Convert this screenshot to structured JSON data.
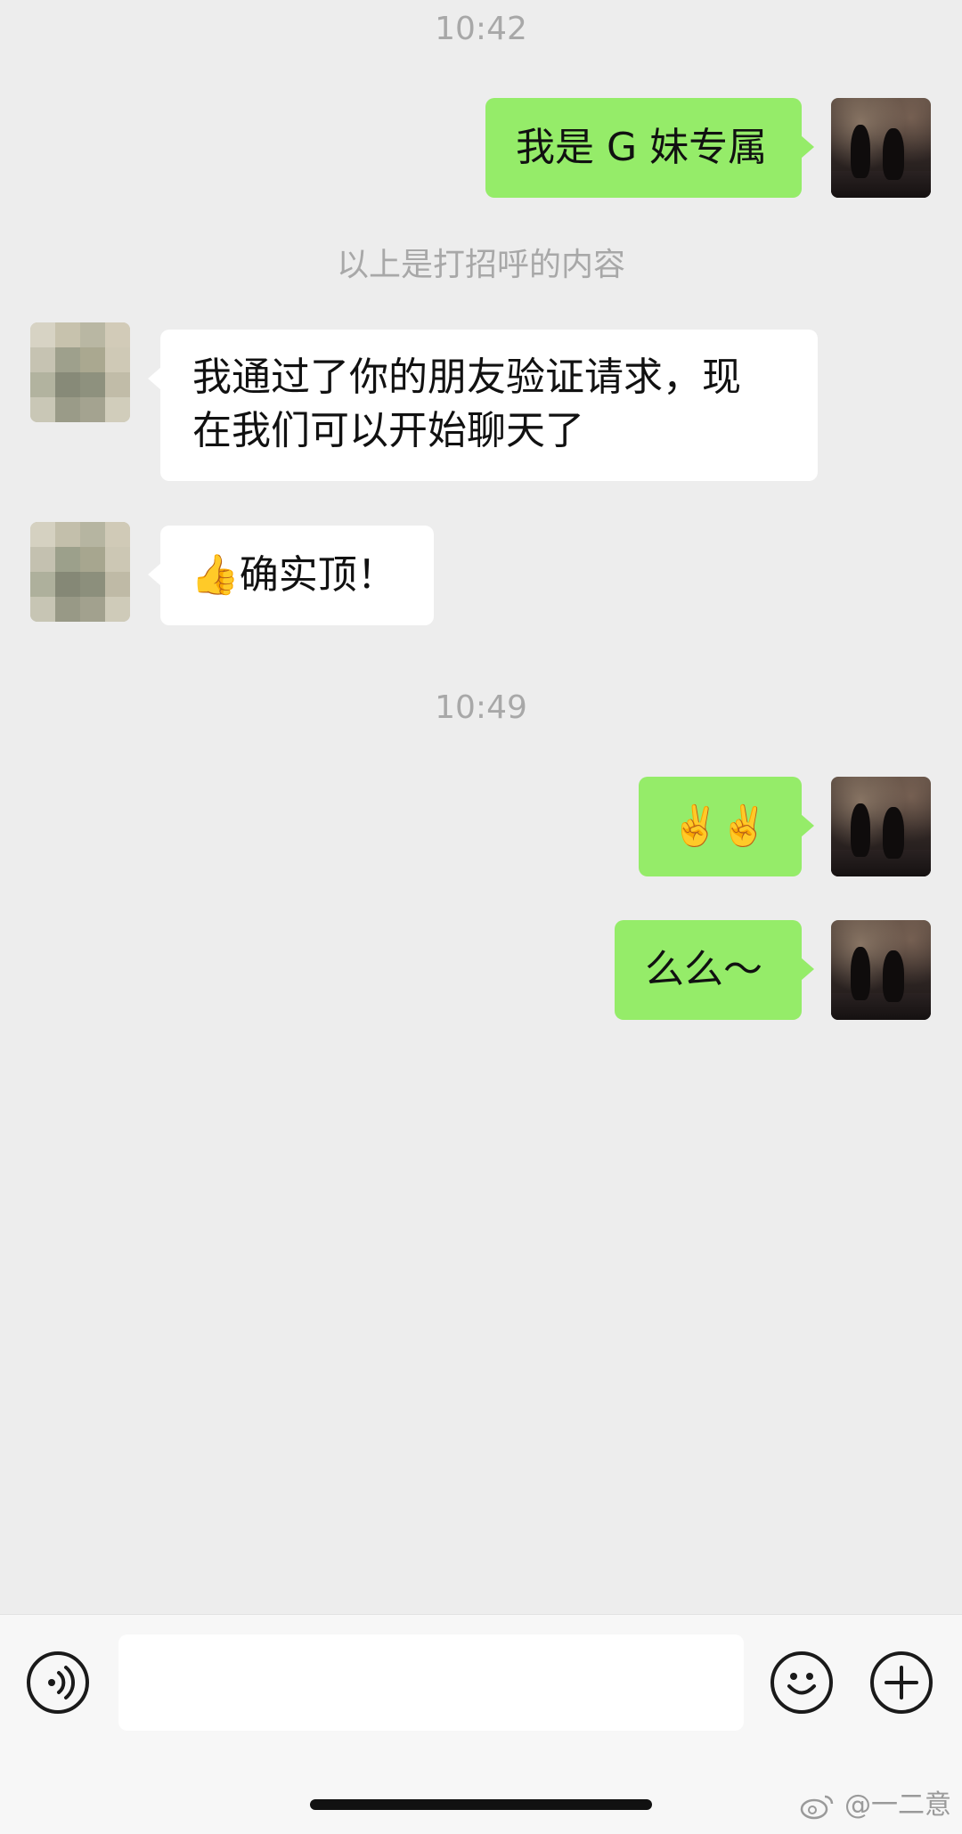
{
  "chat": {
    "time_1": "10:42",
    "system_note": "以上是打招呼的内容",
    "time_2": "10:49",
    "messages": [
      {
        "side": "self",
        "text": "我是 G 妹专属"
      },
      {
        "side": "other",
        "text": "我通过了你的朋友验证请求，现\n在我们可以开始聊天了"
      },
      {
        "side": "other",
        "text": "👍确实顶！"
      },
      {
        "side": "self",
        "text": "✌️✌️"
      },
      {
        "side": "self",
        "text": "么么～"
      }
    ]
  },
  "input_bar": {
    "message_value": "",
    "voice_icon": "voice-icon",
    "emoji_icon": "smiley-icon",
    "more_icon": "plus-icon"
  },
  "watermark": "@一二意",
  "colors": {
    "self_bubble": "#95ec69",
    "other_bubble": "#ffffff",
    "background": "#ededed"
  }
}
